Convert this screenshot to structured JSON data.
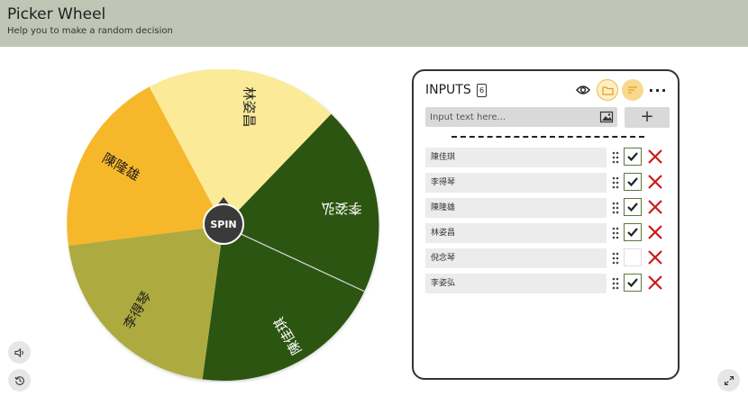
{
  "header": {
    "title": "Picker Wheel",
    "subtitle": "Help you to make a random decision"
  },
  "wheel": {
    "spin_label": "SPIN",
    "segments": [
      {
        "label": "林姿昌",
        "color": "#fbeb98"
      },
      {
        "label": "李姿弘",
        "color": "#2c5511"
      },
      {
        "label": "陳佳琪",
        "color": "#2c5511"
      },
      {
        "label": "李得琴",
        "color": "#adab3f"
      },
      {
        "label": "陳隆雄",
        "color": "#f7b72a"
      }
    ]
  },
  "inputs_panel": {
    "title": "INPUTS",
    "count": "6",
    "placeholder": "Input text here...",
    "add_label": "+",
    "more_label": "···",
    "entries": [
      {
        "name": "陳佳琪",
        "checked": true
      },
      {
        "name": "李得琴",
        "checked": true
      },
      {
        "name": "陳隆雄",
        "checked": true
      },
      {
        "name": "林姿昌",
        "checked": true
      },
      {
        "name": "倪念琴",
        "checked": false
      },
      {
        "name": "李姿弘",
        "checked": true
      }
    ]
  },
  "colors": {
    "header_bg": "#bfc6b5",
    "accent_green": "#2c5511",
    "delete_red": "#cc1a1a",
    "spin_button": "#3a3a3a"
  },
  "icons": {
    "sound": "speaker-icon",
    "history": "history-icon",
    "fullscreen": "expand-icon",
    "eye": "eye-icon",
    "folder": "folder-icon",
    "sort": "sort-icon",
    "image": "image-icon"
  }
}
